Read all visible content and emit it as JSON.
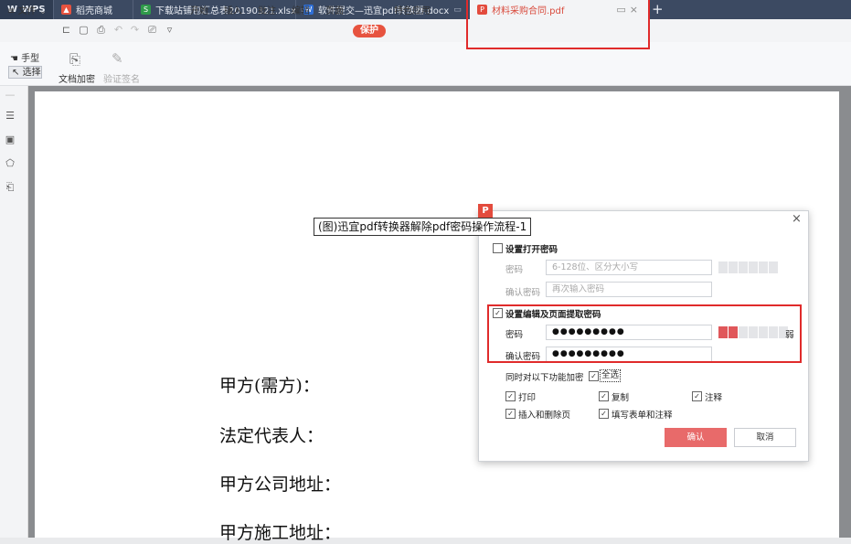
{
  "tabs": {
    "wps": "WPS",
    "t1": "稻壳商城",
    "t2": "下载站铺包汇总表20190321.xlsx",
    "t3": "软件提交—迅宜pdf转换器.docx",
    "active": "材料采购合同.pdf",
    "new_tab": "+"
  },
  "menu": {
    "file": "文件",
    "items": [
      "开始",
      "插入",
      "批注",
      "编辑",
      "页面",
      "保护",
      "特色应用"
    ]
  },
  "ribbon": {
    "hand": "手型",
    "select": "选择",
    "encrypt": "文档加密",
    "verify": "验证签名"
  },
  "document": {
    "caption": "(图)迅宜pdf转换器解除pdf密码操作流程-1",
    "lines": [
      "甲方(需方)：",
      "法定代表人：",
      "甲方公司地址：",
      "甲方施工地址："
    ]
  },
  "dialog": {
    "open_pw_title": "设置打开密码",
    "pw_label": "密码",
    "pw_placeholder": "6-128位、区分大小写",
    "confirm_label": "确认密码",
    "confirm_placeholder": "再次输入密码",
    "edit_pw_title": "设置编辑及页面提取密码",
    "edit_pw_value": "●●●●●●●●●",
    "edit_confirm_value": "●●●●●●●●●",
    "strength_label": "弱",
    "strength_level": "2 of 7",
    "encrypt_functions": "同时对以下功能加密",
    "select_all": "全选",
    "opt_print": "打印",
    "opt_copy": "复制",
    "opt_annot": "注释",
    "opt_insert": "插入和删除页",
    "opt_fill": "填写表单和注释",
    "ok": "确认",
    "cancel": "取消",
    "close": "×"
  },
  "colors": {
    "tabbar": "#3c4a62",
    "accent": "#e7533f",
    "highlight_box": "#e02b2b",
    "ok_button": "#e86a6a"
  }
}
